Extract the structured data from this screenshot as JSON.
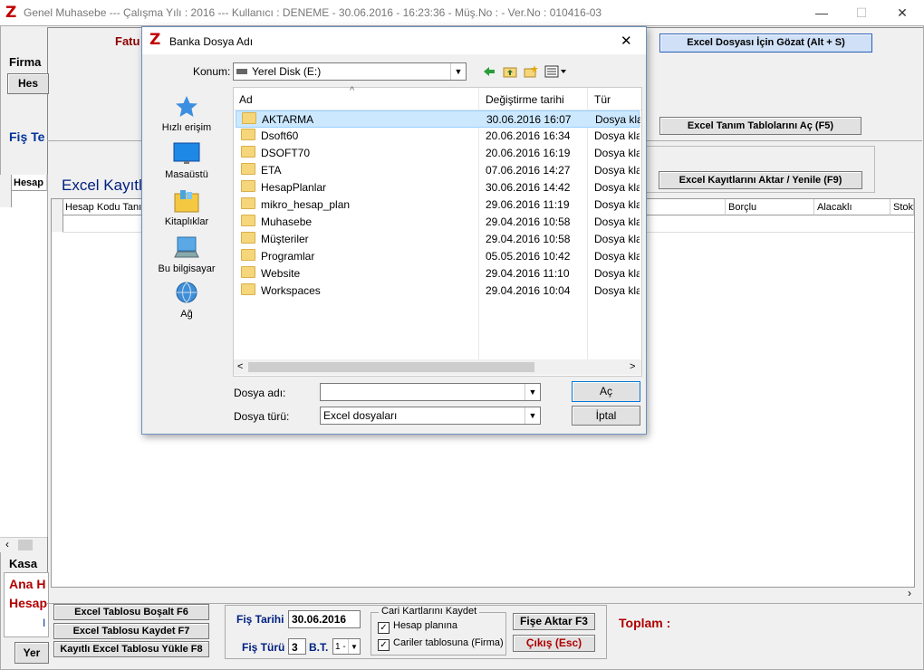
{
  "app": {
    "logo": "Z",
    "title": "Genel Muhasebe  ---  Çalışma Yılı : 2016  ---  Kullanıcı : DENEME - 30.06.2016 - 16:23:36 - Müş.No :  - Ver.No : 010416-03",
    "minimize": "—",
    "maximize": "☐",
    "close": "✕"
  },
  "background": {
    "fatu_label": "Fatu",
    "firma_label": "Firma",
    "hes_button": "Hes",
    "fis_te_label": "Fiş Te",
    "excel_kayit_label": "Excel Kayıtl",
    "left_grid_header": "Hesap",
    "grid_headers": [
      "Hesap Kodu Tanım",
      "Borçlu",
      "Alacaklı",
      "Stok"
    ],
    "btn_gozat": "Excel Dosyası İçin Gözat (Alt + S)",
    "btn_tanim": "Excel Tanım Tablolarını Aç (F5)",
    "btn_aktar": "Excel Kayıtlarını Aktar / Yenile (F9)",
    "kasa_label": "Kasa",
    "ana_h_label": "Ana H",
    "hesap_label": "Hesap",
    "i_label": "I",
    "yer_button": "Yer",
    "scroll_left": "‹",
    "scroll_right": "›"
  },
  "bottom": {
    "btn_bosalt": "Excel Tablosu Boşalt F6",
    "btn_kaydet": "Excel Tablosu Kaydet F7",
    "btn_yukle": "Kayıtlı Excel Tablosu Yükle F8",
    "fis_tarihi_label": "Fiş Tarihi",
    "fis_tarihi_value": "30.06.2016",
    "fis_turu_label": "Fiş Türü",
    "fis_turu_value": "3",
    "bt_label": "B.T.",
    "bt_value": "1 -",
    "cari_group_label": "Cari Kartlarını Kaydet",
    "chk_hesap_label": "Hesap planına",
    "chk_cariler_label": "Cariler tablosuna (Firma)",
    "check_mark": "✓",
    "btn_fise_aktar": "Fişe Aktar F3",
    "btn_cikis": "Çıkış (Esc)",
    "toplam_label": "Toplam :"
  },
  "dialog": {
    "title": "Banka Dosya Adı",
    "close": "✕",
    "konum_label": "Konum:",
    "konum_value": "Yerel Disk (E:)",
    "nav": [
      "Hızlı erişim",
      "Masaüstü",
      "Kitaplıklar",
      "Bu bilgisayar",
      "Ağ"
    ],
    "columns": [
      "Ad",
      "Değiştirme tarihi",
      "Tür"
    ],
    "sort_indicator": "^",
    "files": [
      {
        "name": "AKTARMA",
        "date": "30.06.2016 16:07",
        "type": "Dosya klas"
      },
      {
        "name": "Dsoft60",
        "date": "20.06.2016 16:34",
        "type": "Dosya klas"
      },
      {
        "name": "DSOFT70",
        "date": "20.06.2016 16:19",
        "type": "Dosya klas"
      },
      {
        "name": "ETA",
        "date": "07.06.2016 14:27",
        "type": "Dosya klas"
      },
      {
        "name": "HesapPlanlar",
        "date": "30.06.2016 14:42",
        "type": "Dosya klas"
      },
      {
        "name": "mikro_hesap_plan",
        "date": "29.06.2016 11:19",
        "type": "Dosya klas"
      },
      {
        "name": "Muhasebe",
        "date": "29.04.2016 10:58",
        "type": "Dosya klas"
      },
      {
        "name": "Müşteriler",
        "date": "29.04.2016 10:58",
        "type": "Dosya klas"
      },
      {
        "name": "Programlar",
        "date": "05.05.2016 10:42",
        "type": "Dosya klas"
      },
      {
        "name": "Website",
        "date": "29.04.2016 11:10",
        "type": "Dosya klas"
      },
      {
        "name": "Workspaces",
        "date": "29.04.2016 10:04",
        "type": "Dosya klas"
      }
    ],
    "dosya_adi_label": "Dosya adı:",
    "dosya_adi_value": "",
    "dosya_turu_label": "Dosya türü:",
    "dosya_turu_value": "Excel dosyaları",
    "btn_ac": "Aç",
    "btn_iptal": "İptal",
    "scroll_left": "<",
    "scroll_right": ">",
    "dropdown_arrow": "▼"
  }
}
